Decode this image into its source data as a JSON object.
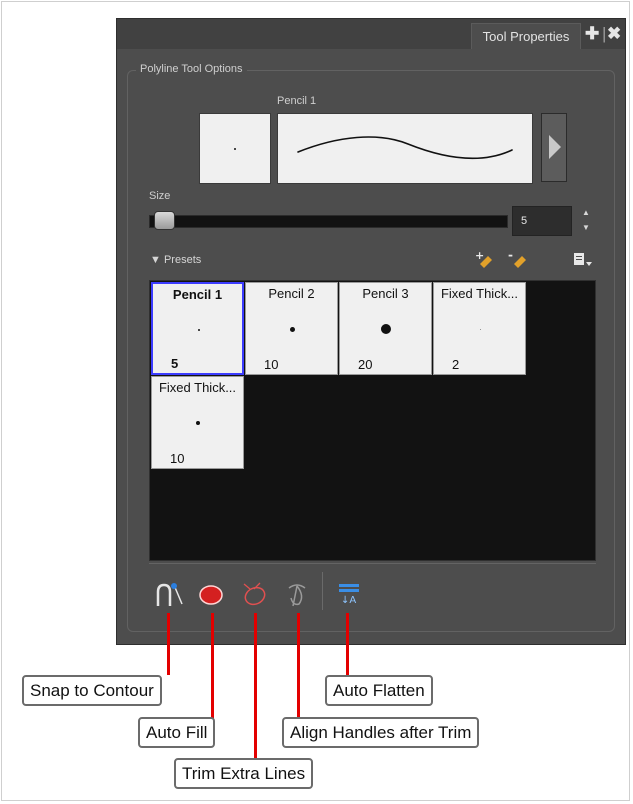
{
  "panel": {
    "tab_label": "Tool Properties",
    "tab_add_glyph": "✚",
    "tab_close_glyph": "✖"
  },
  "group_label": "Polyline Tool Options",
  "brush": {
    "name": "Pencil 1"
  },
  "size": {
    "label": "Size",
    "value": "5",
    "slider_fraction": 0.02
  },
  "presets": {
    "label": "Presets",
    "items": [
      {
        "name": "Pencil 1",
        "size": "5",
        "selected": true
      },
      {
        "name": "Pencil 2",
        "size": "10",
        "selected": false
      },
      {
        "name": "Pencil 3",
        "size": "20",
        "selected": false
      },
      {
        "name": "Fixed Thick...",
        "size": "2",
        "selected": false
      },
      {
        "name": "Fixed Thick...",
        "size": "10",
        "selected": false
      }
    ]
  },
  "toolbar_icons": [
    "snap-to-contour-icon",
    "auto-fill-icon",
    "trim-extra-lines-icon",
    "align-handles-icon",
    "auto-flatten-icon"
  ],
  "callouts": {
    "snap": "Snap to Contour",
    "auto_fill": "Auto Fill",
    "trim": "Trim Extra Lines",
    "align": "Align Handles after Trim",
    "flatten": "Auto Flatten"
  },
  "colors": {
    "panel_bg": "#4d4d4d",
    "selection": "#3c3cff",
    "leader": "#e30000",
    "fill_icon": "#d42020"
  }
}
